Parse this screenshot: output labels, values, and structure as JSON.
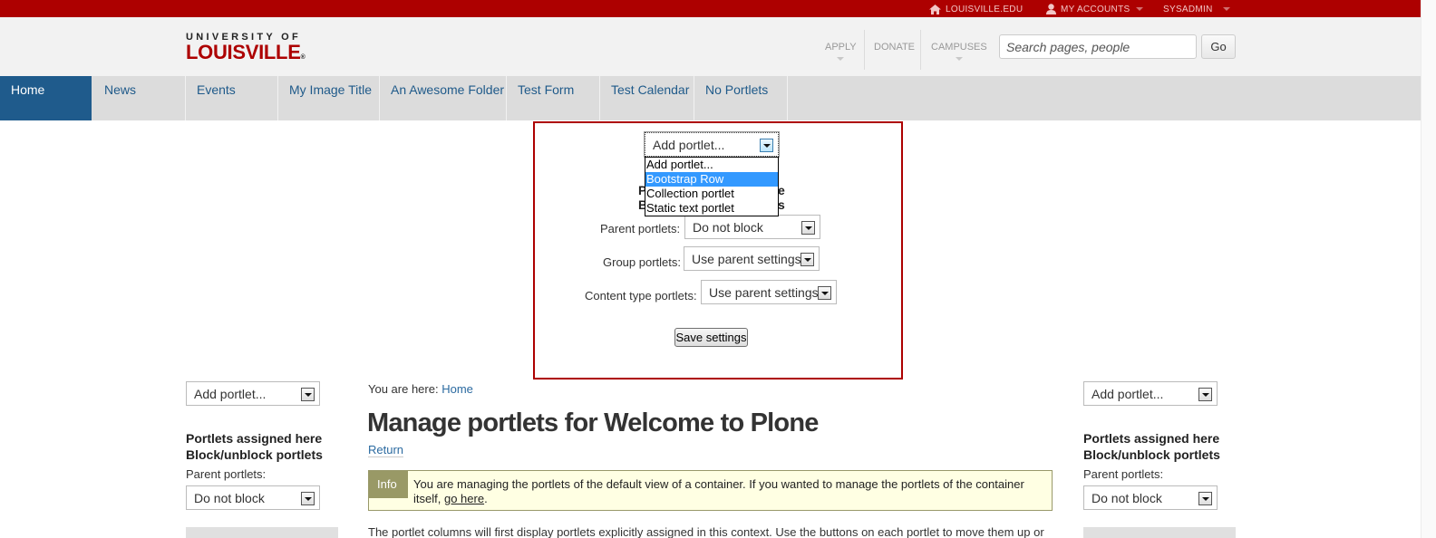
{
  "topbar": {
    "site_link": "LOUISVILLE.EDU",
    "accounts": "MY ACCOUNTS",
    "user": "SYSADMIN",
    "home_icon": "home-icon",
    "user_icon": "user-icon"
  },
  "header": {
    "logo_top": "UNIVERSITY OF",
    "logo_bottom": "LOUISVILLE",
    "logo_mark": "®",
    "links": [
      "APPLY",
      "DONATE",
      "CAMPUSES"
    ],
    "search_placeholder": "Search pages, people",
    "search_value": "",
    "go_label": "Go"
  },
  "nav": {
    "tabs": [
      {
        "label": "Home",
        "active": true
      },
      {
        "label": "News",
        "active": false
      },
      {
        "label": "Events",
        "active": false
      },
      {
        "label": "My Image Title",
        "active": false
      },
      {
        "label": "An Awesome Folder",
        "active": false
      },
      {
        "label": "Test Form",
        "active": false
      },
      {
        "label": "Test Calendar",
        "active": false
      },
      {
        "label": "No Portlets",
        "active": false
      }
    ]
  },
  "panel": {
    "add_portlet_value": "Add portlet...",
    "dropdown_options": [
      "Add portlet...",
      "Bootstrap Row",
      "Collection portlet",
      "Static text portlet"
    ],
    "dropdown_selected_index": 1,
    "hidden_heading_1_left": "P",
    "hidden_heading_1_right": "e",
    "hidden_heading_2_left": "B",
    "hidden_heading_2_right": "s",
    "parent_label": "Parent portlets:",
    "parent_value": "Do not block",
    "group_label": "Group portlets:",
    "group_value": "Use parent settings",
    "content_type_label": "Content type portlets:",
    "content_type_value": "Use parent settings",
    "save_label": "Save settings"
  },
  "left_column": {
    "add_portlet_value": "Add portlet...",
    "heading_assigned": "Portlets assigned here",
    "heading_block": "Block/unblock portlets",
    "parent_label": "Parent portlets:",
    "parent_value": "Do not block"
  },
  "right_column": {
    "add_portlet_value": "Add portlet...",
    "heading_assigned": "Portlets assigned here",
    "heading_block": "Block/unblock portlets",
    "parent_label": "Parent portlets:",
    "parent_value": "Do not block"
  },
  "main": {
    "breadcrumb_prefix": "You are here:",
    "breadcrumb_home": "Home",
    "title": "Manage portlets for Welcome to Plone",
    "return_label": "Return",
    "info_tag": "Info",
    "info_text_1": "You are managing the portlets of the default view of a container. If you wanted to manage the portlets of the container itself,",
    "info_link": "go here",
    "info_text_end": ".",
    "body_text": "The portlet columns will first display portlets explicitly assigned in this context. Use the buttons on each portlet to move them up or"
  },
  "colors": {
    "brand_red": "#ad0000",
    "nav_active": "#1f5b8c",
    "link_blue": "#2b6aa0",
    "info_olive": "#999966",
    "info_bg": "#ffffe3",
    "option_highlight": "#3399ff"
  }
}
